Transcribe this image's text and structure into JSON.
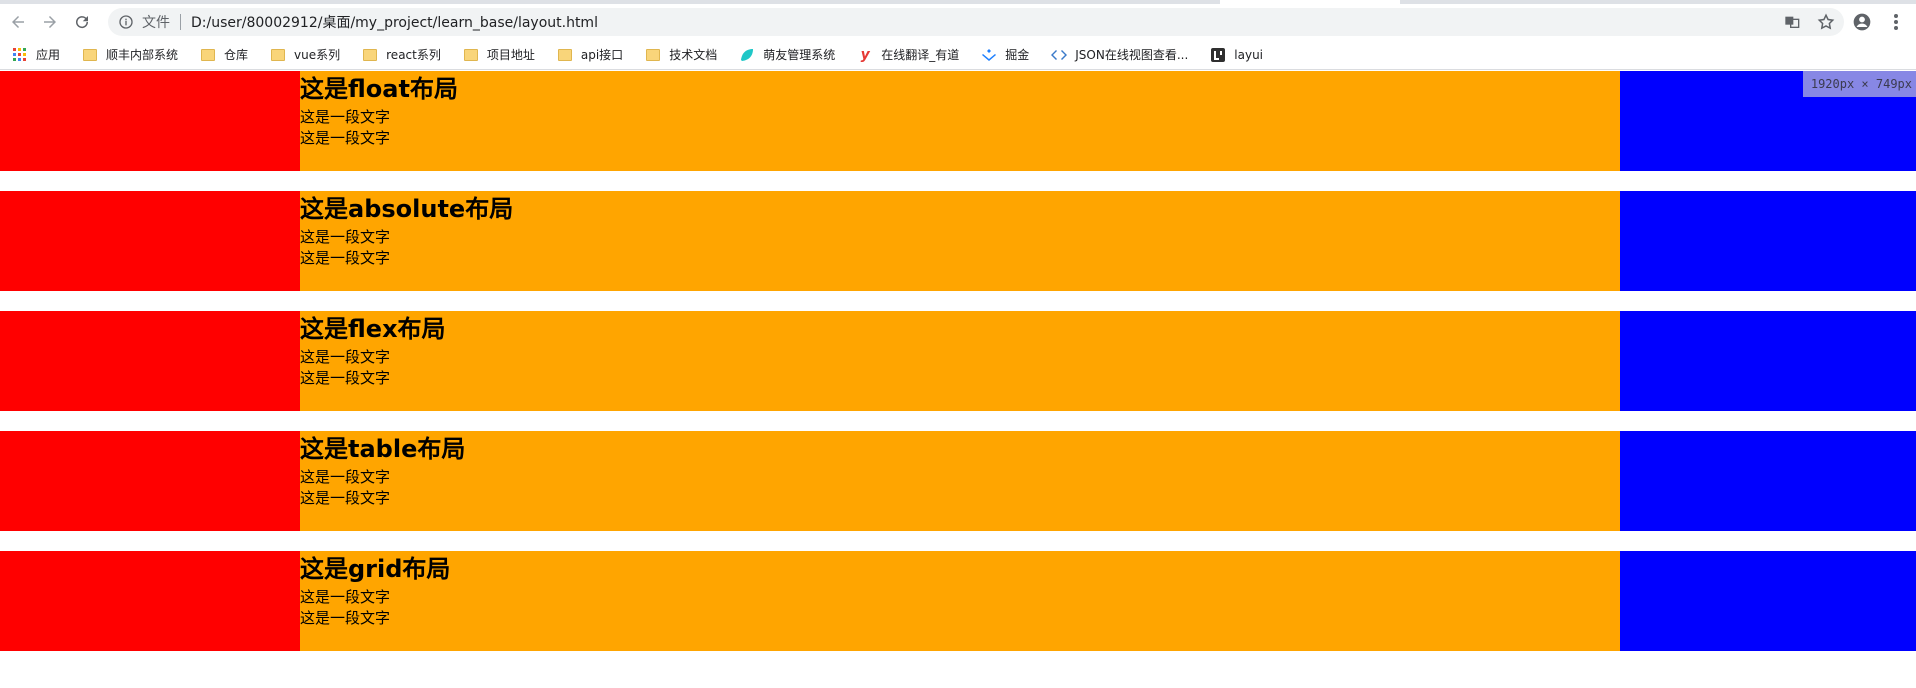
{
  "browser": {
    "address": {
      "scheme_label": "文件",
      "url": "D:/user/80002912/桌面/my_project/learn_base/layout.html"
    },
    "icons": {
      "back": "arrow-left-icon",
      "forward": "arrow-right-icon",
      "reload": "reload-icon",
      "info": "info-icon",
      "translate": "translate-icon",
      "bookmark_star": "star-icon",
      "account": "account-icon",
      "menu": "kebab-menu-icon"
    }
  },
  "bookmarks": [
    {
      "label": "应用",
      "icon": "apps-grid-icon"
    },
    {
      "label": "顺丰内部系统",
      "icon": "folder-icon"
    },
    {
      "label": "仓库",
      "icon": "folder-icon"
    },
    {
      "label": "vue系列",
      "icon": "folder-icon"
    },
    {
      "label": "react系列",
      "icon": "folder-icon"
    },
    {
      "label": "项目地址",
      "icon": "folder-icon"
    },
    {
      "label": "api接口",
      "icon": "folder-icon"
    },
    {
      "label": "技术文档",
      "icon": "folder-icon"
    },
    {
      "label": "萌友管理系统",
      "icon": "leaf-icon"
    },
    {
      "label": "在线翻译_有道",
      "icon": "youdao-icon"
    },
    {
      "label": "掘金",
      "icon": "juejin-icon"
    },
    {
      "label": "JSON在线视图查看...",
      "icon": "code-icon"
    },
    {
      "label": "layui",
      "icon": "layui-icon"
    }
  ],
  "viewport_badge": "1920px × 749px",
  "colors": {
    "left": "#ff0000",
    "center": "#ffa500",
    "right": "#0000ff"
  },
  "sections": [
    {
      "title": "这是float布局",
      "line1": "这是一段文字",
      "line2": "这是一段文字"
    },
    {
      "title": "这是absolute布局",
      "line1": "这是一段文字",
      "line2": "这是一段文字"
    },
    {
      "title": "这是flex布局",
      "line1": "这是一段文字",
      "line2": "这是一段文字"
    },
    {
      "title": "这是table布局",
      "line1": "这是一段文字",
      "line2": "这是一段文字"
    },
    {
      "title": "这是grid布局",
      "line1": "这是一段文字",
      "line2": "这是一段文字"
    }
  ]
}
